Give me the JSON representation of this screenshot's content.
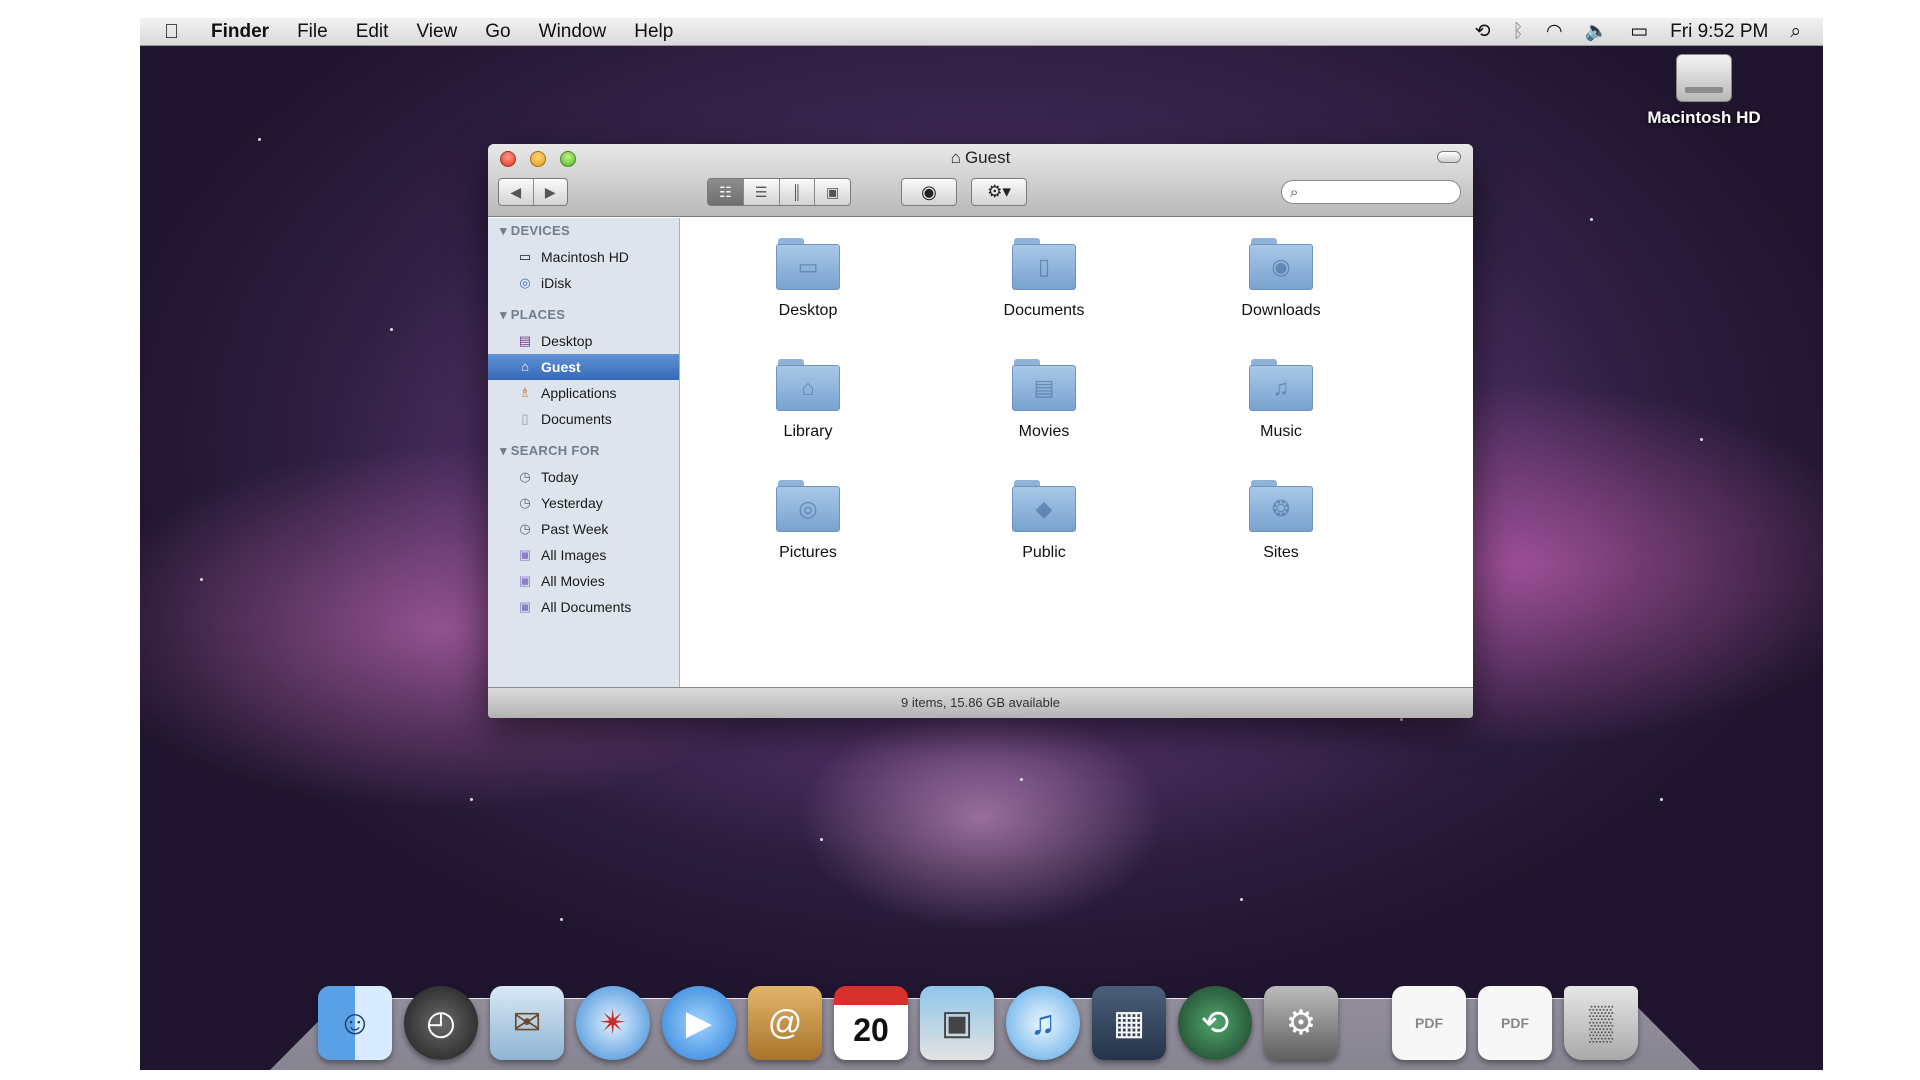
{
  "menubar": {
    "apple": "",
    "app_name": "Finder",
    "menus": [
      "File",
      "Edit",
      "View",
      "Go",
      "Window",
      "Help"
    ],
    "clock": "Fri 9:52 PM",
    "status_icons": [
      "time-machine-icon",
      "bluetooth-icon",
      "wifi-icon",
      "volume-icon",
      "battery-icon",
      "spotlight-icon"
    ]
  },
  "desktop": {
    "hd_label": "Macintosh HD"
  },
  "window": {
    "title": "Guest",
    "search_placeholder": "",
    "view_modes": [
      "icon",
      "list",
      "column",
      "cover-flow"
    ],
    "active_view": "icon",
    "status": "9 items, 15.86 GB available"
  },
  "sidebar": {
    "devices_head": "DEVICES",
    "devices": [
      "Macintosh HD",
      "iDisk"
    ],
    "places_head": "PLACES",
    "places": [
      "Desktop",
      "Guest",
      "Applications",
      "Documents"
    ],
    "search_head": "SEARCH FOR",
    "searches": [
      "Today",
      "Yesterday",
      "Past Week",
      "All Images",
      "All Movies",
      "All Documents"
    ],
    "selected": "Guest"
  },
  "folders": [
    "Desktop",
    "Documents",
    "Downloads",
    "Library",
    "Movies",
    "Music",
    "Pictures",
    "Public",
    "Sites"
  ],
  "dock": {
    "calendar_day": "20",
    "apps": [
      "finder",
      "dashboard",
      "mail",
      "safari",
      "ichat",
      "address-book",
      "ical",
      "iphoto",
      "itunes",
      "spaces",
      "time-machine",
      "system-preferences"
    ],
    "stacks": [
      "pdf-document",
      "pdf-document"
    ],
    "trash": "trash"
  },
  "colors": {
    "selection": "#3569b8",
    "folder": "#8fb2d6"
  }
}
